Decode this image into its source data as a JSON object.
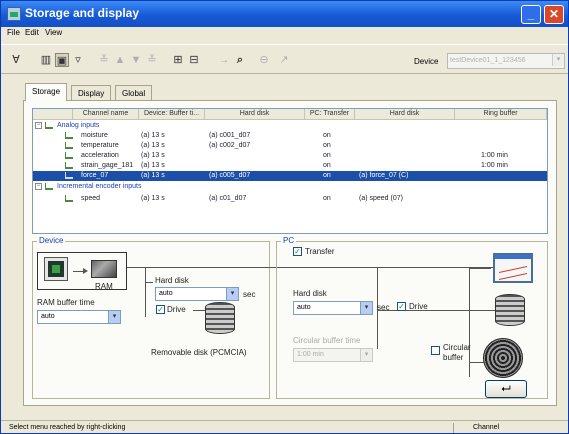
{
  "window": {
    "title": "Storage and display"
  },
  "menu": [
    {
      "label": "File"
    },
    {
      "label": "Edit"
    },
    {
      "label": "View"
    }
  ],
  "toolbar": {
    "device_label": "Device",
    "device_value": "testDevice01_1_123456",
    "icons": [
      "filter-icon",
      "storage-view-icon",
      "display-view-icon",
      "filter-dropdown-icon",
      "align-left-icon",
      "move-up-icon",
      "move-down-icon",
      "align-bottom-icon",
      "group-icon",
      "ungroup-icon",
      "step-right-icon",
      "search-icon",
      "zoom-icon",
      "pin-icon"
    ]
  },
  "tabs": [
    {
      "label": "Storage"
    },
    {
      "label": "Display"
    },
    {
      "label": "Global"
    }
  ],
  "grid": {
    "columns": [
      "Channel name",
      "Device: Buffer ti...",
      "Hard disk",
      "PC: Transfer",
      "Hard disk",
      "Ring buffer"
    ],
    "groups": [
      {
        "name": "Analog inputs",
        "rows": [
          {
            "name": "moisture",
            "buffer": "(a) 13 s",
            "hard_disk": "(a) c001_d07",
            "transfer": "on",
            "pc_disk": "",
            "ring": ""
          },
          {
            "name": "temperature",
            "buffer": "(a) 13 s",
            "hard_disk": "(a) c002_d07",
            "transfer": "on",
            "pc_disk": "",
            "ring": ""
          },
          {
            "name": "acceleration",
            "buffer": "(a) 13 s",
            "hard_disk": "",
            "transfer": "on",
            "pc_disk": "",
            "ring": "1:00 min"
          },
          {
            "name": "strain_gage_181",
            "buffer": "(a) 13 s",
            "hard_disk": "",
            "transfer": "on",
            "pc_disk": "",
            "ring": "1:00 min"
          },
          {
            "name": "force_07",
            "buffer": "(a) 13 s",
            "hard_disk": "(a) c005_d07",
            "transfer": "on",
            "pc_disk": "(a) force_07 (C)",
            "ring": "",
            "selected": true
          }
        ]
      },
      {
        "name": "Incremental encoder inputs",
        "rows": [
          {
            "name": "speed",
            "buffer": "(a) 13 s",
            "hard_disk": "(a) c01_d07",
            "transfer": "on",
            "pc_disk": "(a) speed (07)",
            "ring": ""
          }
        ]
      }
    ]
  },
  "device": {
    "title": "Device",
    "ram_label": "RAM",
    "ram_buffer_label": "RAM buffer time",
    "ram_buffer_value": "auto",
    "hard_disk_label": "Hard disk",
    "hard_disk_value": "auto",
    "hard_disk_unit": "sec",
    "drive_label": "Drive",
    "removable_label": "Removable disk (PCMCIA)"
  },
  "pc": {
    "title": "PC",
    "transfer_label": "Transfer",
    "hard_disk_label": "Hard disk",
    "hard_disk_value": "auto",
    "hard_disk_unit": "sec",
    "drive_label": "Drive",
    "circular_buffer_time_label": "Circular buffer time",
    "circular_buffer_time_value": "1:00 min",
    "circular_buffer_label_1": "Circular",
    "circular_buffer_label_2": "buffer",
    "return_glyph": "⮠"
  },
  "status": {
    "left": "Select menu reached by right-clicking",
    "right": "Channel"
  }
}
